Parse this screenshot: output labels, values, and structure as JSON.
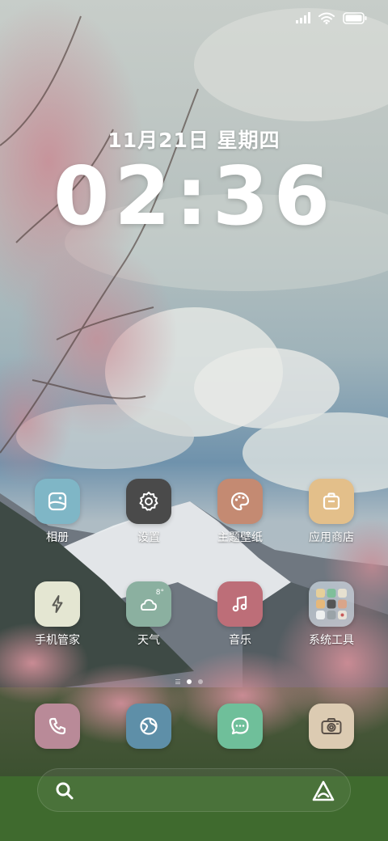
{
  "status_bar": {
    "signal_icon": "signal-bars-icon",
    "wifi_icon": "wifi-icon",
    "battery_icon": "battery-icon",
    "battery_level": 1.0
  },
  "clock": {
    "date": "11月21日 星期四",
    "time": "02:36"
  },
  "apps": [
    {
      "label": "相册",
      "icon": "gallery-icon",
      "color": "#7fb6c6"
    },
    {
      "label": "设置",
      "icon": "gear-icon",
      "color": "#4a4a4a"
    },
    {
      "label": "主题壁纸",
      "icon": "palette-icon",
      "color": "#c48a72"
    },
    {
      "label": "应用商店",
      "icon": "store-bag-icon",
      "color": "#e3bf8a"
    },
    {
      "label": "手机管家",
      "icon": "lightning-icon",
      "color": "#e4e6d2"
    },
    {
      "label": "天气",
      "icon": "weather-cloud-sun-icon",
      "color": "#8bb0a0",
      "badge": "8°"
    },
    {
      "label": "音乐",
      "icon": "music-note-icon",
      "color": "#bd6e78"
    },
    {
      "label": "系统工具",
      "icon": "folder-icon",
      "color": "#a9b7c2"
    }
  ],
  "dock": [
    {
      "icon": "phone-icon",
      "color": "#b98a98"
    },
    {
      "icon": "browser-globe-icon",
      "color": "#5e8fa8"
    },
    {
      "icon": "message-icon",
      "color": "#6fbf9a"
    },
    {
      "icon": "camera-icon",
      "color": "#dccbb2"
    }
  ],
  "page_indicator": {
    "current": 1,
    "total": 2
  },
  "search_bar": {
    "search_icon": "search-icon",
    "assistant_icon": "assistant-a-icon"
  }
}
